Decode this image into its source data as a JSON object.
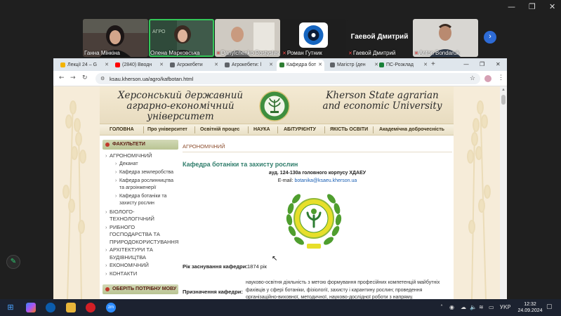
{
  "zoom": {
    "window_controls": [
      "—",
      "❐",
      "✕"
    ],
    "participants": [
      {
        "name": "Ганна Мінкіна",
        "muted": false
      },
      {
        "name": "Олена Марковська",
        "muted": false,
        "active": true
      },
      {
        "name": "Danylchenko Rostyslav",
        "muted": true
      },
      {
        "name": "Роман Гутник",
        "muted": true
      },
      {
        "name": "Гаевой Дмитрий",
        "muted": true,
        "big_name": "Гаевой Дмитрий"
      },
      {
        "name": "Anton Bondaruk",
        "muted": true
      }
    ],
    "next_label": "›"
  },
  "browser": {
    "tabs": [
      {
        "label": "Лекції 24 – G",
        "color": "#f4b400"
      },
      {
        "label": "(2840) Вводн",
        "color": "#ff0000"
      },
      {
        "label": "Агрокебети",
        "color": "#5f6368"
      },
      {
        "label": "Агрокебети: l",
        "color": "#5f6368"
      },
      {
        "label": "Кафедра бот",
        "color": "#2e7d32",
        "active": true
      },
      {
        "label": "Магістр (ден",
        "color": "#5f6368"
      },
      {
        "label": "ПС-Розклад",
        "color": "#188038"
      }
    ],
    "new_tab": "+",
    "controls": [
      "—",
      "❐",
      "✕"
    ],
    "url": "ksau.kherson.ua/agro/kafbotan.html"
  },
  "site": {
    "header_ua": "Херсонський державний аграрно-економічний університет",
    "header_en": "Kherson State agrarian and economic University",
    "nav": [
      "ГОЛОВНА",
      "Про університет",
      "Освітній процес",
      "НАУКА",
      "АБІТУРІЄНТУ",
      "ЯКІСТЬ ОСВІТИ",
      "Академічна доброчесність"
    ],
    "sidebar_title": "ФАКУЛЬТЕТИ",
    "sidebar_faculty": "АГРОНОМІЧНИЙ",
    "sidebar_subitems": [
      "Деканат",
      "Кафедра землеробства",
      "Кафедра рослинництва та агроінженерії",
      "Кафедра ботаніки та захисту рослин"
    ],
    "sidebar_items": [
      "БІОЛОГО-ТЕХНОЛОГІЧНИЙ",
      "РИБНОГО ГОСПОДАРСТВА ТА ПРИРОДОКОРИСТУВАННЯ",
      "АРХІТЕКТУРИ ТА БУДІВНИЦТВА",
      "ЕКОНОМІЧНИЙ",
      "КОНТАКТИ"
    ],
    "language_title": "ОБЕРІТЬ ПОТРІБНУ МОВУ",
    "breadcrumb": "АГРОНОМІЧНИЙ",
    "dept_title": "Кафедра ботаніки та захисту рослин",
    "room": "ауд. 124-130а головного корпусу ХДАЕУ",
    "email_label": "E-mail:",
    "email": "botanika@ksaeu.kherson.ua",
    "founded_label": "Рік заснування кафедри:",
    "founded_value": "1874 рік",
    "purpose_label": "Призначення кафедри:",
    "purpose_text": "науково-освітня діяльність з метою формування професійних компетенцій майбутніх фахівців у сфері ботаніки, фізіології, захисту і карантину рослин; проведення організаційно-виховної, методичної, науково-дослідної роботи з напряму."
  },
  "taskbar": {
    "tray_lang": "УКР",
    "time": "12:32",
    "date": "24.09.2024",
    "app_zoom_label": "zm"
  }
}
